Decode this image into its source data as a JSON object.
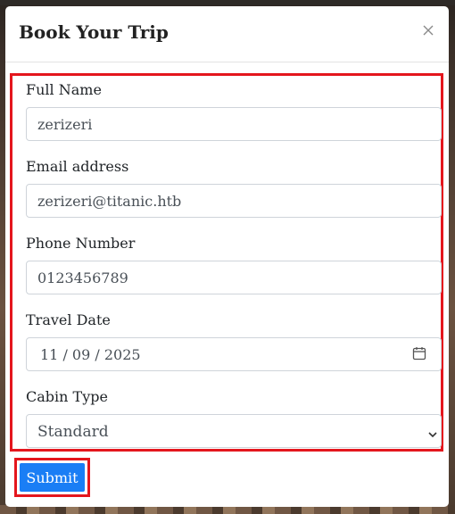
{
  "modal": {
    "title": "Book Your Trip",
    "close_icon": "close-icon"
  },
  "form": {
    "full_name": {
      "label": "Full Name",
      "value": "zerizeri"
    },
    "email": {
      "label": "Email address",
      "value": "zerizeri@titanic.htb"
    },
    "phone": {
      "label": "Phone Number",
      "value": "0123456789"
    },
    "travel_date": {
      "label": "Travel Date",
      "value": "11 / 09 / 2025",
      "icon": "calendar-icon"
    },
    "cabin_type": {
      "label": "Cabin Type",
      "value": "Standard",
      "icon": "chevron-down-icon"
    },
    "submit_label": "Submit"
  },
  "colors": {
    "accent": "#1a7ef5",
    "highlight_border": "#e4161d"
  }
}
